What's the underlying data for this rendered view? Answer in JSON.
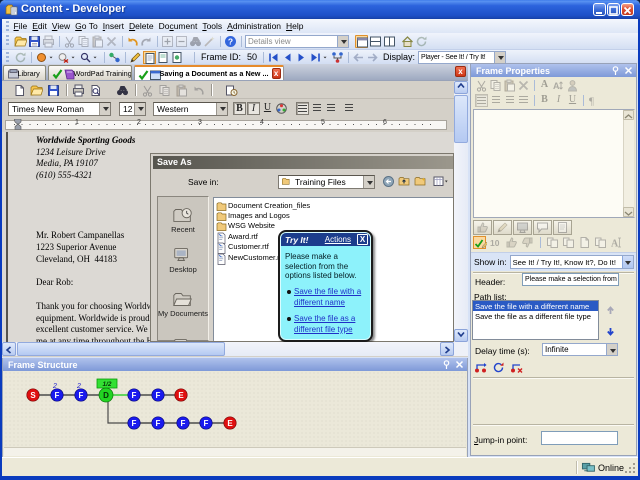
{
  "window": {
    "title": "Content - Developer"
  },
  "menu": {
    "items": [
      {
        "pre": "",
        "key": "F",
        "post": "ile"
      },
      {
        "pre": "",
        "key": "E",
        "post": "dit"
      },
      {
        "pre": "",
        "key": "V",
        "post": "iew"
      },
      {
        "pre": "",
        "key": "G",
        "post": "o To"
      },
      {
        "pre": "",
        "key": "I",
        "post": "nsert"
      },
      {
        "pre": "",
        "key": "D",
        "post": "elete"
      },
      {
        "pre": "Do",
        "key": "c",
        "post": "ument"
      },
      {
        "pre": "",
        "key": "T",
        "post": "ools"
      },
      {
        "pre": "",
        "key": "A",
        "post": "dministration"
      },
      {
        "pre": "",
        "key": "H",
        "post": "elp"
      }
    ]
  },
  "toolbar": {
    "details_view": "Details view",
    "frame_id_label": "Frame ID:",
    "frame_id_value": "50",
    "display_label": "Display:",
    "display_value": "Player - See It! / Try It!"
  },
  "tabs": [
    {
      "label": "Library"
    },
    {
      "label": "WordPad Training"
    },
    {
      "label": "Saving a Document as a New ..."
    }
  ],
  "wordpad": {
    "font_name": "Times New Roman",
    "font_size": "12",
    "script": "Western",
    "ruler_numbers": [
      "1",
      "2",
      "3",
      "4",
      "5",
      "6"
    ]
  },
  "letter": {
    "letterhead": [
      "Worldwide Sporting Goods",
      "1234 Leisure Drive",
      "Media, PA 19107",
      "(610) 555-4321"
    ],
    "body": [
      "Mr. Robert Campanellas",
      "1223 Superior Avenue",
      "Cleveland, OH  44183",
      " ",
      "Dear Rob:",
      " ",
      "Thank you for choosing Worldwide",
      "equipment. Worldwide is proud of",
      "excellent customer service. We hav",
      "me at any time throughout the H"
    ]
  },
  "save_as": {
    "title": "Save As",
    "save_in_label": "Save in:",
    "location": "Training Files",
    "places": [
      "Recent",
      "Desktop",
      "My Documents"
    ],
    "files": [
      {
        "name": "Document Creation_files"
      },
      {
        "name": "Images and Logos"
      },
      {
        "name": "WSG Website"
      },
      {
        "name": "Award.rtf"
      },
      {
        "name": "Customer.rtf"
      },
      {
        "name": "NewCustomer.rt"
      }
    ]
  },
  "tryit": {
    "title": "Try It!",
    "actions_label": "Actions",
    "message_lines": [
      "Please make a",
      "selection from the",
      "options listed below."
    ],
    "options": [
      {
        "line1": "Save the file with a",
        "line2": "different name"
      },
      {
        "line1": "Save the file as a",
        "line2": "different file type"
      }
    ]
  },
  "frame_properties": {
    "title": "Frame Properties",
    "show_in_label": "Show in:",
    "show_in_value": "See It! / Try It!, Know It?, Do It!",
    "header_label": "Header:",
    "header_value": "Please make a selection from",
    "path_list_label": "Path list:",
    "path_items": [
      "Save the file with a different name",
      "Save the file as a different file type"
    ],
    "delay_label": "Delay time (s):",
    "delay_value": "Infinite",
    "jump_label": {
      "key": "J",
      "post": "ump-in point:"
    },
    "jump_value": ""
  },
  "frame_structure": {
    "title": "Frame Structure",
    "row1": [
      "S",
      "F",
      "F",
      "D",
      "F",
      "F",
      "E"
    ],
    "row2": [
      "F",
      "F",
      "F",
      "F",
      "E"
    ],
    "branch_labels": [
      "2",
      "2"
    ],
    "decision_label": "1/2"
  },
  "status": {
    "online": "Online"
  },
  "colors": {
    "titlebar_blue": "#2a63d8",
    "panel_title_blue": "#8ca5e0",
    "balloon_cyan": "#8df2fb",
    "balloon_navy": "#1c3d8c",
    "selection_blue": "#2a5ac4",
    "node_red": "#e01010",
    "node_blue": "#1a1aee",
    "node_green": "#22d422",
    "active_tab_orange": "#e68b2c"
  }
}
